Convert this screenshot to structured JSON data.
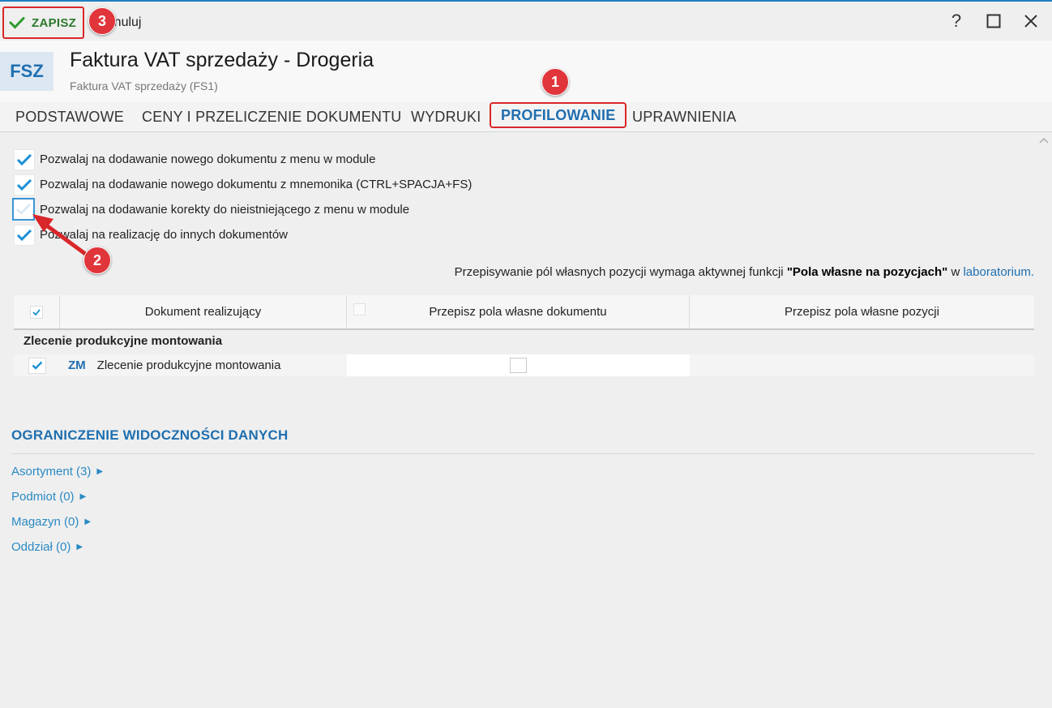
{
  "toolbar": {
    "save_label": "ZAPISZ",
    "cancel_label": "Anuluj",
    "help_glyph": "?",
    "maximize_glyph": "☐",
    "close_glyph": "✕"
  },
  "header": {
    "doc_code": "FSZ",
    "title": "Faktura VAT sprzedaży - Drogeria",
    "subtitle": "Faktura VAT sprzedaży (FS1)"
  },
  "tabs": [
    {
      "label": "PODSTAWOWE",
      "active": false
    },
    {
      "label": "CENY I PRZELICZENIE DOKUMENTU",
      "active": false
    },
    {
      "label": "WYDRUKI",
      "active": false
    },
    {
      "label": "PROFILOWANIE",
      "active": true
    },
    {
      "label": "UPRAWNIENIA",
      "active": false
    }
  ],
  "options": [
    {
      "label": "Pozwalaj na dodawanie nowego dokumentu z menu w module",
      "checked": true
    },
    {
      "label": "Pozwalaj na dodawanie nowego dokumentu z mnemonika (CTRL+SPACJA+FS)",
      "checked": true
    },
    {
      "label": "Pozwalaj na dodawanie korekty do nieistniejącego z menu w module",
      "checked": false
    },
    {
      "label": "Pozwalaj na realizację do innych dokumentów",
      "checked": true
    }
  ],
  "info": {
    "text_before": "Przepisywanie pól własnych pozycji wymaga aktywnej funkcji ",
    "bold": "\"Pola własne na pozycjach\"",
    "text_mid": " w ",
    "link": "laboratorium."
  },
  "table": {
    "headers": [
      "Dokument realizujący",
      "Przepisz pola własne dokumentu",
      "Przepisz pola własne pozycji"
    ],
    "group": "Zlecenie produkcyjne montowania",
    "rows": [
      {
        "checked": true,
        "code": "ZM",
        "name": "Zlecenie produkcyjne montowania",
        "copy_doc_fields": false
      }
    ]
  },
  "section": {
    "title": "OGRANICZENIE WIDOCZNOŚCI DANYCH",
    "links": [
      "Asortyment (3)",
      "Podmiot (0)",
      "Magazyn (0)",
      "Oddział (0)"
    ]
  },
  "annotations": [
    "1",
    "2",
    "3"
  ],
  "colors": {
    "accent": "#1f6fb0",
    "check": "#1a8fd6",
    "save_green": "#2b7a2b",
    "annotation_red": "#e0353a"
  },
  "icons": {
    "save": "checkmark-icon",
    "cancel": "x-icon",
    "expand": "triangle-right-icon"
  }
}
